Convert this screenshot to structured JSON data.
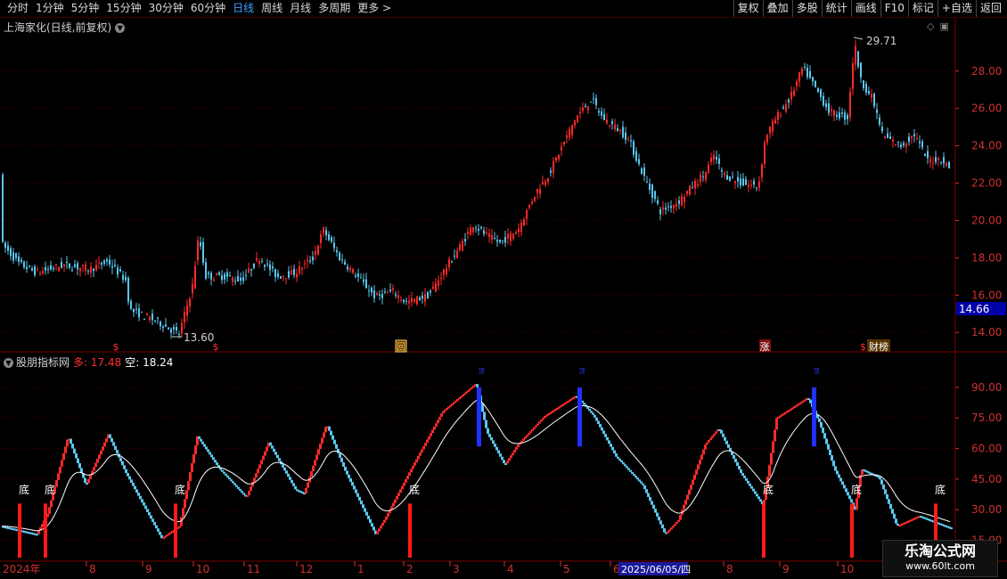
{
  "toolbar": {
    "periods": [
      "分时",
      "1分钟",
      "5分钟",
      "15分钟",
      "30分钟",
      "60分钟",
      "日线",
      "周线",
      "月线",
      "多周期",
      "更多 >"
    ],
    "active_period": "日线",
    "actions": [
      "复权",
      "叠加",
      "多股",
      "统计",
      "画线",
      "F10",
      "标记",
      "+自选",
      "返回"
    ]
  },
  "stock_title": "上海家化(日线,前复权)",
  "price_axis": [
    "28.00",
    "26.00",
    "24.00",
    "22.00",
    "20.00",
    "18.00",
    "16.00",
    "14.00"
  ],
  "current_price": "14.66",
  "high_label": "29.71",
  "low_label": "13.60",
  "event_markers": [
    {
      "label": "$",
      "color": "#ff3030"
    },
    {
      "label": "$",
      "color": "#ff3030"
    },
    {
      "label": "回",
      "color": "#ffcc66"
    },
    {
      "label": "涨",
      "color": "#ffffff"
    },
    {
      "label": "财榜",
      "color": "#ffffff"
    }
  ],
  "indicator": {
    "name": "股朋指标网",
    "duo_label": "多: 17.48",
    "kong_label": "空: 18.24",
    "axis": [
      "90.00",
      "75.00",
      "60.00",
      "45.00",
      "30.00",
      "15.00"
    ],
    "bottom_label": "底",
    "top_mark_label": "顶"
  },
  "date_axis": {
    "start_label": "2024年",
    "months": [
      "8",
      "9",
      "10",
      "11",
      "12",
      "1",
      "2",
      "3",
      "4",
      "5",
      "6",
      "8",
      "9",
      "10"
    ],
    "cursor_date": "2025/06/05/四"
  },
  "colors": {
    "up": "#ff2a2a",
    "down": "#5ac8f0",
    "ma": "#ffffff",
    "grid": "#7a0000",
    "axis_text": "#d03030"
  },
  "watermark": {
    "line1": "乐淘公式网",
    "line2": "www.60lt.com"
  }
}
